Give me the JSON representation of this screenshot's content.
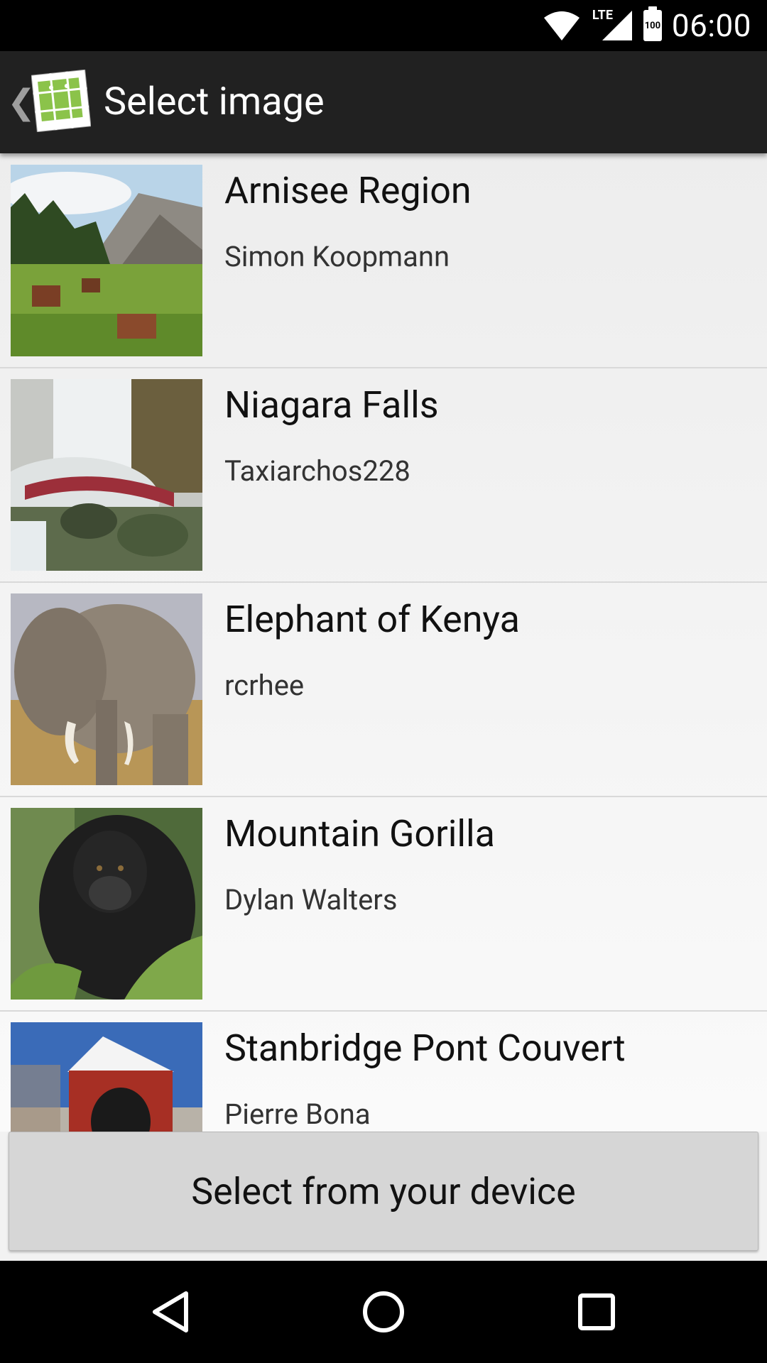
{
  "status_bar": {
    "time": "06:00",
    "network": "LTE",
    "battery": "100",
    "icons": [
      "wifi-icon",
      "lte-signal-icon",
      "battery-icon"
    ]
  },
  "action_bar": {
    "title": "Select image",
    "icons": [
      "back-chevron-icon",
      "app-logo-icon"
    ]
  },
  "images": [
    {
      "title": "Arnisee Region",
      "author": "Simon Koopmann",
      "thumb": "mountain-village-thumbnail"
    },
    {
      "title": "Niagara Falls",
      "author": "Taxiarchos228",
      "thumb": "waterfall-thumbnail"
    },
    {
      "title": "Elephant of Kenya",
      "author": "rcrhee",
      "thumb": "elephant-thumbnail"
    },
    {
      "title": "Mountain Gorilla",
      "author": "Dylan Walters",
      "thumb": "gorilla-thumbnail"
    },
    {
      "title": "Stanbridge Pont Couvert",
      "author": "Pierre Bona",
      "thumb": "covered-bridge-thumbnail"
    }
  ],
  "select_button": {
    "label": "Select from your device"
  },
  "nav_bar": {
    "icons": [
      "back-triangle-icon",
      "home-circle-icon",
      "recents-square-icon"
    ]
  },
  "colors": {
    "action_bar": "#212121",
    "list_bg": "#f2f2f2",
    "button": "#d6d6d6"
  }
}
